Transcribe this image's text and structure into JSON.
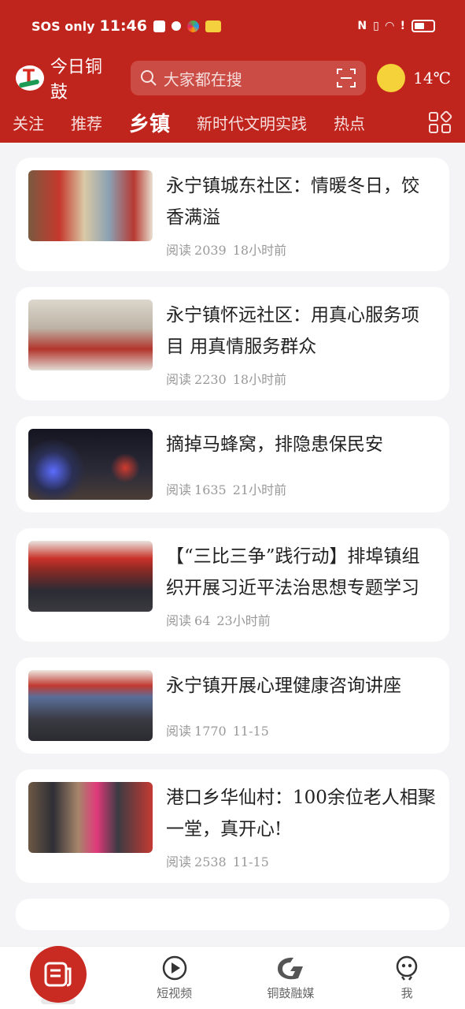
{
  "status_bar": {
    "carrier": "SOS only",
    "time": "11:46"
  },
  "header": {
    "app_name": "今日铜鼓",
    "search_placeholder": "大家都在搜",
    "temperature": "14℃"
  },
  "tabs": [
    {
      "label": "关注",
      "active": false
    },
    {
      "label": "推荐",
      "active": false
    },
    {
      "label": "乡镇",
      "active": true
    },
    {
      "label": "新时代文明实践",
      "active": false
    },
    {
      "label": "热点",
      "active": false
    }
  ],
  "articles": [
    {
      "title": "永宁镇城东社区：情暖冬日，饺香满溢",
      "reads_label": "阅读",
      "reads": "2039",
      "time": "18小时前"
    },
    {
      "title": "永宁镇怀远社区：用真心服务项目 用真情服务群众",
      "reads_label": "阅读",
      "reads": "2230",
      "time": "18小时前"
    },
    {
      "title": "摘掉马蜂窝，排隐患保民安",
      "reads_label": "阅读",
      "reads": "1635",
      "time": "21小时前"
    },
    {
      "title": "【“三比三争”践行动】排埠镇组织开展习近平法治思想专题学习",
      "reads_label": "阅读",
      "reads": "64",
      "time": "23小时前"
    },
    {
      "title": "永宁镇开展心理健康咨询讲座",
      "reads_label": "阅读",
      "reads": "1770",
      "time": "11-15"
    },
    {
      "title": "港口乡华仙村：100余位老人相聚一堂，真开心!",
      "reads_label": "阅读",
      "reads": "2538",
      "time": "11-15"
    }
  ],
  "bottom_nav": [
    {
      "label": "",
      "icon": "news-icon",
      "active": true
    },
    {
      "label": "短视频",
      "icon": "play-icon",
      "active": false
    },
    {
      "label": "铜鼓融媒",
      "icon": "brand-icon",
      "active": false
    },
    {
      "label": "我",
      "icon": "profile-icon",
      "active": false
    }
  ],
  "colors": {
    "brand_red": "#c0251d",
    "sun": "#f6d23a"
  }
}
